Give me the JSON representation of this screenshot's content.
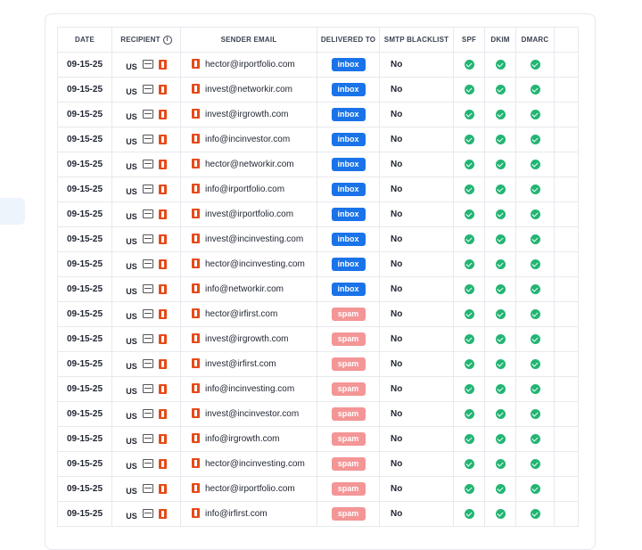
{
  "headers": {
    "date": "DATE",
    "recipient": "RECIPIENT",
    "sender_email": "SENDER EMAIL",
    "delivered_to": "DELIVERED TO",
    "smtp_blacklist": "SMTP BLACKLIST",
    "spf": "SPF",
    "dkim": "DKIM",
    "dmarc": "DMARC"
  },
  "icons": {
    "info": "info-icon",
    "inbox": "inbox-tray-icon",
    "office": "office365-icon",
    "check": "check-circle-icon"
  },
  "colors": {
    "inbox_badge": "#1a73e8",
    "spam_badge": "#f49596",
    "check": "#22b573"
  },
  "rows": [
    {
      "date": "09-15-25",
      "country": "US",
      "sender": "hector@irportfolio.com",
      "delivered": "inbox",
      "blacklist": "No"
    },
    {
      "date": "09-15-25",
      "country": "US",
      "sender": "invest@networkir.com",
      "delivered": "inbox",
      "blacklist": "No"
    },
    {
      "date": "09-15-25",
      "country": "US",
      "sender": "invest@irgrowth.com",
      "delivered": "inbox",
      "blacklist": "No"
    },
    {
      "date": "09-15-25",
      "country": "US",
      "sender": "info@incinvestor.com",
      "delivered": "inbox",
      "blacklist": "No"
    },
    {
      "date": "09-15-25",
      "country": "US",
      "sender": "hector@networkir.com",
      "delivered": "inbox",
      "blacklist": "No"
    },
    {
      "date": "09-15-25",
      "country": "US",
      "sender": "info@irportfolio.com",
      "delivered": "inbox",
      "blacklist": "No"
    },
    {
      "date": "09-15-25",
      "country": "US",
      "sender": "invest@irportfolio.com",
      "delivered": "inbox",
      "blacklist": "No"
    },
    {
      "date": "09-15-25",
      "country": "US",
      "sender": "invest@incinvesting.com",
      "delivered": "inbox",
      "blacklist": "No"
    },
    {
      "date": "09-15-25",
      "country": "US",
      "sender": "hector@incinvesting.com",
      "delivered": "inbox",
      "blacklist": "No"
    },
    {
      "date": "09-15-25",
      "country": "US",
      "sender": "info@networkir.com",
      "delivered": "inbox",
      "blacklist": "No"
    },
    {
      "date": "09-15-25",
      "country": "US",
      "sender": "hector@irfirst.com",
      "delivered": "spam",
      "blacklist": "No"
    },
    {
      "date": "09-15-25",
      "country": "US",
      "sender": "invest@irgrowth.com",
      "delivered": "spam",
      "blacklist": "No"
    },
    {
      "date": "09-15-25",
      "country": "US",
      "sender": "invest@irfirst.com",
      "delivered": "spam",
      "blacklist": "No"
    },
    {
      "date": "09-15-25",
      "country": "US",
      "sender": "info@incinvesting.com",
      "delivered": "spam",
      "blacklist": "No"
    },
    {
      "date": "09-15-25",
      "country": "US",
      "sender": "invest@incinvestor.com",
      "delivered": "spam",
      "blacklist": "No"
    },
    {
      "date": "09-15-25",
      "country": "US",
      "sender": "info@irgrowth.com",
      "delivered": "spam",
      "blacklist": "No"
    },
    {
      "date": "09-15-25",
      "country": "US",
      "sender": "hector@incinvesting.com",
      "delivered": "spam",
      "blacklist": "No"
    },
    {
      "date": "09-15-25",
      "country": "US",
      "sender": "hector@irportfolio.com",
      "delivered": "spam",
      "blacklist": "No"
    },
    {
      "date": "09-15-25",
      "country": "US",
      "sender": "info@irfirst.com",
      "delivered": "spam",
      "blacklist": "No"
    }
  ]
}
